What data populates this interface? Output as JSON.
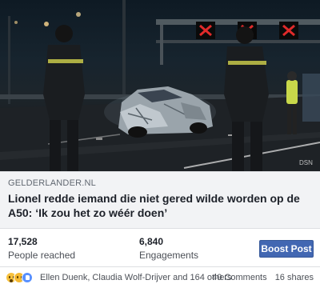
{
  "post": {
    "domain": "GELDERLANDER.NL",
    "headline": "Lionel redde iemand die niet gered wilde worden op de A50: ‘Ik zou het zo wéér doen’",
    "photo_credit": "DSN"
  },
  "stats": {
    "reached_value": "17,528",
    "reached_label": "People reached",
    "engagements_value": "6,840",
    "engagements_label": "Engagements",
    "boost_label": "Boost Post"
  },
  "reactions": {
    "icons": [
      "wow-icon",
      "sad-icon",
      "like-icon"
    ],
    "names": "Ellen Duenk, Claudia Wolf-Drijver and 164 others",
    "comments": "40 Comments",
    "shares": "16 shares"
  },
  "colors": {
    "boost": "#4267b2",
    "signal_red": "#d8232a",
    "link_bg": "#f2f3f5"
  }
}
